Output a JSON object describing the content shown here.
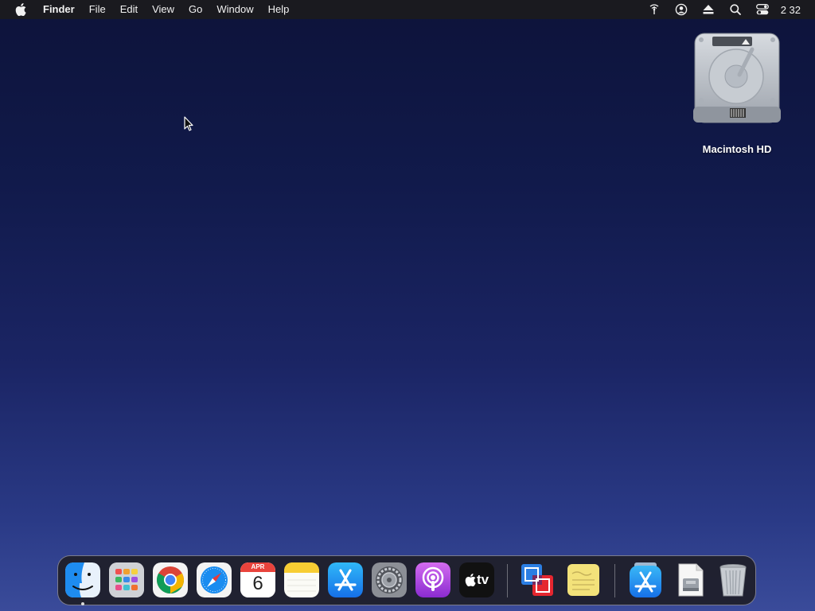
{
  "menubar": {
    "apple_icon": "apple-logo-icon",
    "app_name": "Finder",
    "menus": [
      "File",
      "Edit",
      "View",
      "Go",
      "Window",
      "Help"
    ],
    "status_icons": [
      "network-icon",
      "user-account-icon",
      "eject-icon",
      "spotlight-search-icon",
      "control-center-icon"
    ],
    "clock": "2 32"
  },
  "desktop": {
    "icons": [
      {
        "label": "Macintosh HD",
        "icon": "hard-drive-icon"
      }
    ]
  },
  "dock": {
    "apps": [
      {
        "name": "Finder",
        "icon": "finder-icon",
        "running": true
      },
      {
        "name": "Launchpad",
        "icon": "launchpad-icon"
      },
      {
        "name": "Google Chrome",
        "icon": "chrome-icon"
      },
      {
        "name": "Safari",
        "icon": "safari-icon"
      },
      {
        "name": "Calendar",
        "icon": "calendar-icon",
        "month": "APR",
        "day": "6"
      },
      {
        "name": "Notes",
        "icon": "notes-icon"
      },
      {
        "name": "App Store",
        "icon": "app-store-icon"
      },
      {
        "name": "System Preferences",
        "icon": "system-preferences-icon"
      },
      {
        "name": "Podcasts",
        "icon": "podcasts-icon"
      },
      {
        "name": "TV",
        "icon": "apple-tv-icon",
        "text": "tv"
      },
      {
        "name": "VMware Fusion",
        "icon": "vmware-fusion-icon"
      },
      {
        "name": "Stickies",
        "icon": "stickies-icon"
      },
      {
        "name": "App Store Downloads",
        "icon": "app-store-folder-icon"
      },
      {
        "name": "Installer Disk",
        "icon": "disk-image-icon"
      },
      {
        "name": "Trash",
        "icon": "trash-icon"
      }
    ]
  },
  "colors": {
    "menubar_bg": "#1a1a1f",
    "desktop_top": "#0d133a",
    "desktop_bottom": "#3a4b9a"
  }
}
